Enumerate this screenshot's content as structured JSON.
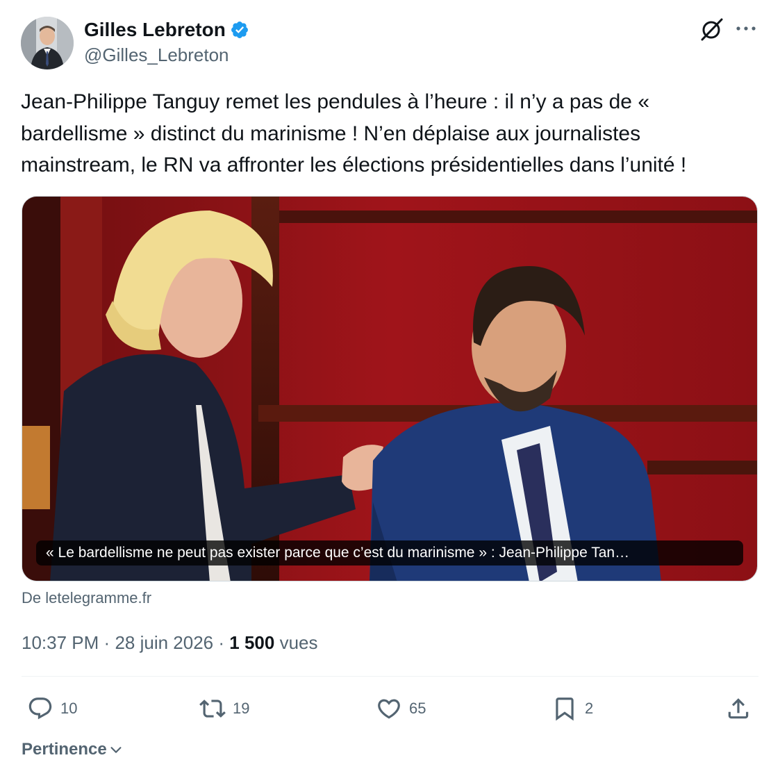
{
  "author": {
    "display_name": "Gilles Lebreton",
    "handle": "@Gilles_Lebreton",
    "verified": true
  },
  "tweet": {
    "text": "Jean-Philippe Tanguy remet les pendules à l’heure : il n’y a pas de « bardellisme » distinct du marinisme ! N’en déplaise aux journalistes mainstream, le RN va affronter les élections présidentielles dans l’unité !"
  },
  "link_card": {
    "caption": "« Le bardellisme ne peut pas exister parce que c’est du marinisme » : Jean-Philippe Tan…",
    "source": "De letelegramme.fr"
  },
  "meta": {
    "time": "10:37 PM",
    "separator": "·",
    "date": "28 juin 2026",
    "views_count": "1 500",
    "views_label": "vues"
  },
  "actions": {
    "replies": "10",
    "reposts": "19",
    "likes": "65",
    "bookmarks": "2"
  },
  "sort": {
    "label": "Pertinence"
  },
  "icons": [
    "verified-badge-icon",
    "grok-icon",
    "more-icon",
    "reply-icon",
    "repost-icon",
    "like-icon",
    "bookmark-icon",
    "share-icon",
    "chevron-down-icon"
  ],
  "colors": {
    "verified": "#1d9bf0",
    "secondary_text": "#536471",
    "primary_text": "#0f1419"
  }
}
